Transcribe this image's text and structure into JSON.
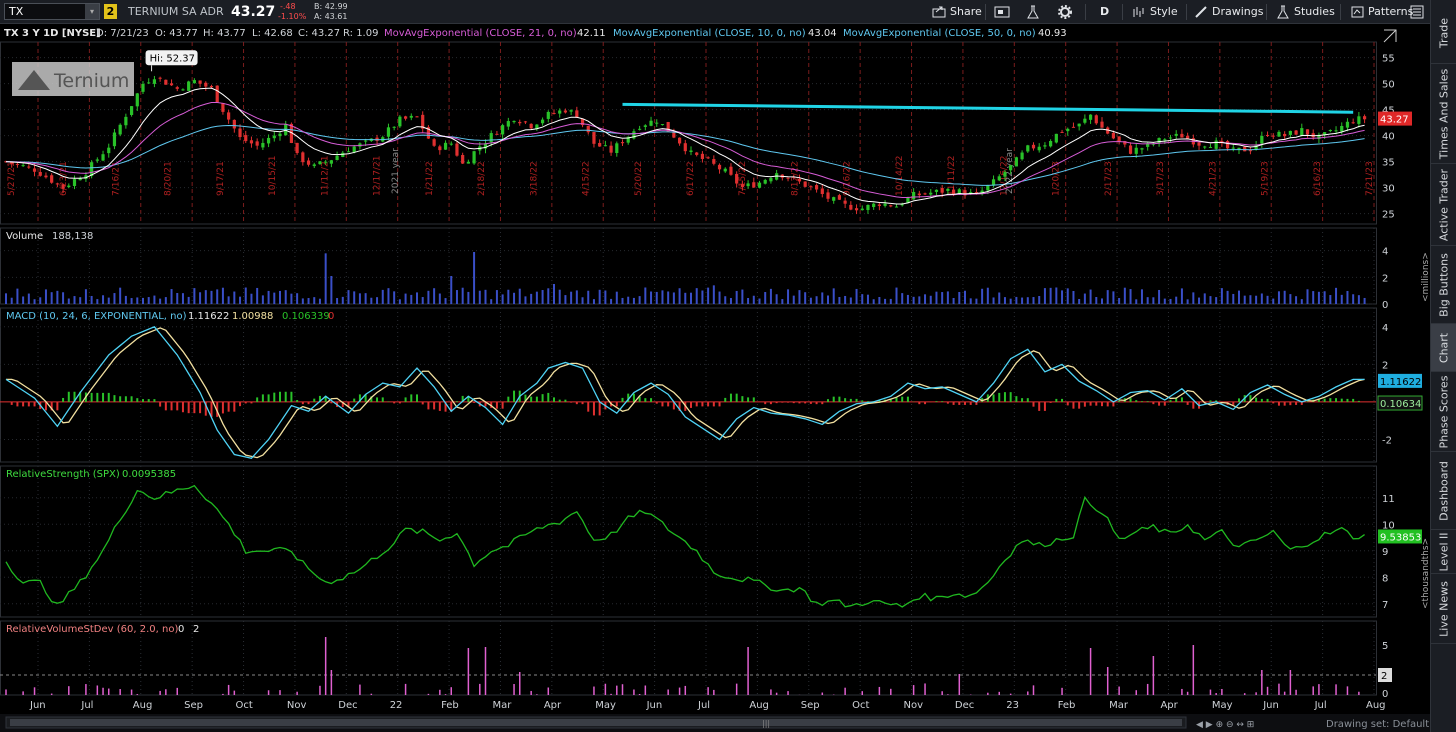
{
  "toolbar": {
    "symbol": "TX",
    "link_badge": "2",
    "company": "TERNIUM SA ADR",
    "last": "43.27",
    "change": "-.48",
    "change_pct": "-1.10%",
    "bid": "B: 42.99",
    "ask": "A: 43.61",
    "share": "Share",
    "period": "D",
    "style": "Style",
    "drawings": "Drawings",
    "studies": "Studies",
    "patterns": "Patterns"
  },
  "right_tabs": [
    "Trade",
    "Times And Sales",
    "Active Trader",
    "Big Buttons",
    "Chart",
    "Phase Scores",
    "Dashboard",
    "Level II",
    "Live News"
  ],
  "price_header": {
    "title": "TX 3 Y 1D [NYSE]",
    "date": "D: 7/21/23",
    "open": "O: 43.77",
    "high": "H: 43.77",
    "low": "L: 42.68",
    "close": "C: 43.27",
    "range": "R: 1.09",
    "ma21_label": "MovAvgExponential (CLOSE, 21, 0, no)",
    "ma21_value": "42.11",
    "ma10_label": "MovAvgExponential (CLOSE, 10, 0, no)",
    "ma10_value": "43.04",
    "ma50_label": "MovAvgExponential (CLOSE, 50, 0, no)",
    "ma50_value": "40.93"
  },
  "logo_text": "Ternium",
  "hi_label": "Hi: 52.37",
  "price_marker": "43.27",
  "year_labels": [
    "2021 year",
    "2022 year"
  ],
  "volume_header": {
    "label": "Volume",
    "value": "188,138"
  },
  "volume_unit": "<millions>",
  "macd_header": {
    "label": "MACD (10, 24, 6, EXPONENTIAL, no)",
    "v1": "1.11622",
    "v2": "1.00988",
    "v3": "0.106339",
    "v4": "0"
  },
  "macd_markers": {
    "macd": "1.11622",
    "diff": "0.10634"
  },
  "rs_header": {
    "label": "RelativeStrength (SPX)",
    "value": "0.0095385"
  },
  "rs_marker": "9.53853",
  "rs_unit": "<thousandths>",
  "rv_header": {
    "label": "RelativeVolumeStDev (60, 2.0, no)",
    "v1": "0",
    "v2": "2"
  },
  "rv_marker": "2",
  "footer": {
    "drawing_set": "Drawing set: Default"
  },
  "colors": {
    "up": "#29c229",
    "down": "#e03030",
    "ma21": "#d65cd6",
    "ma10": "#ffffff",
    "ma50": "#5fc8f0",
    "trendline": "#20d4e6",
    "macd": "#4fd3f5",
    "signal": "#f2e0a0",
    "rs": "#20b820",
    "rv": "#e060d0"
  },
  "chart_data": [
    {
      "type": "candlestick",
      "title": "TX 3 Y 1D [NYSE]",
      "series": [
        {
          "name": "MovAvgExponential (CLOSE, 21, 0, no)"
        },
        {
          "name": "MovAvgExponential (CLOSE, 10, 0, no)"
        },
        {
          "name": "MovAvgExponential (CLOSE, 50, 0, no)"
        }
      ],
      "ylim": [
        23,
        58
      ],
      "yticks": [
        25,
        30,
        35,
        40,
        45,
        50,
        55
      ],
      "x_month_labels": [
        "Jun",
        "Jul",
        "Aug",
        "Sep",
        "Oct",
        "Nov",
        "Dec",
        "22",
        "Feb",
        "Mar",
        "Apr",
        "May",
        "Jun",
        "Jul",
        "Aug",
        "Sep",
        "Oct",
        "Nov",
        "Dec",
        "23",
        "Feb",
        "Mar",
        "Apr",
        "May",
        "Jun",
        "Jul",
        "Aug"
      ],
      "date_labels": [
        "5/27/21",
        "6/23/21",
        "7/16/21",
        "8/20/21",
        "9/17/21",
        "10/15/21",
        "11/12/21",
        "12/17/21",
        "1/21/22",
        "2/18/22",
        "3/18/22",
        "4/15/22",
        "5/20/22",
        "6/17/22",
        "7/15/22",
        "8/12/22",
        "9/16/22",
        "10/14/22",
        "11/11/22",
        "12/16/22",
        "1/20/23",
        "2/17/23",
        "3/17/23",
        "4/21/23",
        "5/19/23",
        "6/16/23",
        "7/21/23"
      ],
      "close_path": [
        [
          0,
          35
        ],
        [
          5,
          33.5
        ],
        [
          10,
          30
        ],
        [
          14,
          33
        ],
        [
          18,
          38
        ],
        [
          21,
          44
        ],
        [
          24,
          50
        ],
        [
          26,
          51.5
        ],
        [
          30,
          49
        ],
        [
          33,
          50.5
        ],
        [
          36,
          49
        ],
        [
          38,
          45
        ],
        [
          41,
          39.5
        ],
        [
          44,
          38
        ],
        [
          47,
          40
        ],
        [
          49,
          42
        ],
        [
          51,
          36
        ],
        [
          54,
          34
        ],
        [
          57,
          35.5
        ],
        [
          60,
          37.5
        ],
        [
          63,
          38.5
        ],
        [
          66,
          40
        ],
        [
          69,
          43
        ],
        [
          72,
          43.5
        ],
        [
          75,
          37.5
        ],
        [
          78,
          38.5
        ],
        [
          80,
          34.5
        ],
        [
          83,
          38
        ],
        [
          86,
          41
        ],
        [
          89,
          43.5
        ],
        [
          92,
          42
        ],
        [
          95,
          44
        ],
        [
          98,
          45
        ],
        [
          100,
          44
        ],
        [
          103,
          38.5
        ],
        [
          106,
          37
        ],
        [
          109,
          40
        ],
        [
          111,
          42
        ],
        [
          114,
          43
        ],
        [
          117,
          40
        ],
        [
          120,
          36.5
        ],
        [
          123,
          35
        ],
        [
          126,
          33
        ],
        [
          129,
          30
        ],
        [
          132,
          31
        ],
        [
          135,
          33
        ],
        [
          138,
          31.5
        ],
        [
          141,
          30
        ],
        [
          144,
          28
        ],
        [
          147,
          26.5
        ],
        [
          150,
          26
        ],
        [
          153,
          27
        ],
        [
          156,
          26.5
        ],
        [
          159,
          28.5
        ],
        [
          162,
          29
        ],
        [
          165,
          29.5
        ],
        [
          168,
          29
        ],
        [
          170,
          28.5
        ],
        [
          173,
          31
        ],
        [
          176,
          34
        ],
        [
          179,
          37.5
        ],
        [
          182,
          38.5
        ],
        [
          185,
          41
        ],
        [
          188,
          42
        ],
        [
          190,
          44
        ],
        [
          192,
          41.5
        ],
        [
          194,
          39.5
        ],
        [
          197,
          37
        ],
        [
          200,
          38
        ],
        [
          203,
          39.5
        ],
        [
          206,
          40
        ],
        [
          209,
          38.5
        ],
        [
          212,
          38.5
        ],
        [
          215,
          37
        ],
        [
          218,
          37.5
        ],
        [
          221,
          40.5
        ],
        [
          224,
          40
        ],
        [
          227,
          41
        ],
        [
          230,
          39.5
        ],
        [
          233,
          41
        ],
        [
          236,
          43
        ],
        [
          238,
          43.27
        ]
      ],
      "hi": 52.37,
      "trendline": [
        [
          108,
          46.0
        ],
        [
          236,
          44.5
        ]
      ]
    },
    {
      "type": "bar",
      "title": "Volume",
      "unit": "millions",
      "ylim": [
        0,
        4.2
      ],
      "yticks": [
        0,
        2,
        4
      ],
      "last": 188138,
      "spikes": [
        [
          56,
          3.8
        ],
        [
          57,
          2.1
        ],
        [
          78,
          2.1
        ],
        [
          82,
          3.9
        ],
        [
          96,
          1.5
        ],
        [
          124,
          1.4
        ],
        [
          167,
          0.9
        ]
      ]
    },
    {
      "type": "line",
      "title": "MACD (10, 24, 6, EXPONENTIAL, no)",
      "ylim": [
        -3.2,
        5
      ],
      "yticks": [
        -2,
        2,
        4
      ],
      "series": [
        {
          "name": "MACD",
          "values_path": [
            [
              0,
              1.2
            ],
            [
              5,
              0.2
            ],
            [
              9,
              -1.3
            ],
            [
              13,
              0.5
            ],
            [
              18,
              2.5
            ],
            [
              22,
              3.5
            ],
            [
              26,
              4.0
            ],
            [
              30,
              2.5
            ],
            [
              34,
              0.5
            ],
            [
              37,
              -1.5
            ],
            [
              40,
              -2.8
            ],
            [
              43,
              -3.0
            ],
            [
              46,
              -2.0
            ],
            [
              50,
              -0.2
            ],
            [
              53,
              -0.5
            ],
            [
              56,
              0.3
            ],
            [
              60,
              -0.6
            ],
            [
              63,
              0.4
            ],
            [
              66,
              1.0
            ],
            [
              69,
              0.8
            ],
            [
              72,
              1.8
            ],
            [
              75,
              0.8
            ],
            [
              78,
              -0.5
            ],
            [
              81,
              0.3
            ],
            [
              84,
              -0.3
            ],
            [
              87,
              -1.2
            ],
            [
              90,
              0.3
            ],
            [
              93,
              1.0
            ],
            [
              95,
              1.8
            ],
            [
              98,
              2.1
            ],
            [
              101,
              1.8
            ],
            [
              104,
              0
            ],
            [
              107,
              -0.6
            ],
            [
              110,
              0.5
            ],
            [
              113,
              1.0
            ],
            [
              116,
              0.4
            ],
            [
              119,
              -0.8
            ],
            [
              122,
              -1.4
            ],
            [
              125,
              -2.0
            ],
            [
              128,
              -0.9
            ],
            [
              131,
              -0.3
            ],
            [
              134,
              -0.6
            ],
            [
              137,
              -0.7
            ],
            [
              140,
              -0.9
            ],
            [
              143,
              -1.2
            ],
            [
              146,
              -0.5
            ],
            [
              149,
              -0.1
            ],
            [
              152,
              0.0
            ],
            [
              155,
              0.3
            ],
            [
              158,
              1.0
            ],
            [
              161,
              0.7
            ],
            [
              164,
              0.8
            ],
            [
              167,
              0.4
            ],
            [
              170,
              0.0
            ],
            [
              173,
              1.0
            ],
            [
              176,
              2.3
            ],
            [
              179,
              2.8
            ],
            [
              182,
              1.6
            ],
            [
              185,
              2.0
            ],
            [
              188,
              1.1
            ],
            [
              191,
              0.6
            ],
            [
              194,
              0.0
            ],
            [
              197,
              0.5
            ],
            [
              200,
              0.6
            ],
            [
              203,
              0.1
            ],
            [
              206,
              0.7
            ],
            [
              209,
              -0.2
            ],
            [
              212,
              0.0
            ],
            [
              215,
              -0.4
            ],
            [
              218,
              0.5
            ],
            [
              221,
              0.9
            ],
            [
              224,
              0.4
            ],
            [
              227,
              0.0
            ],
            [
              230,
              0.3
            ],
            [
              233,
              0.8
            ],
            [
              236,
              1.2
            ]
          ]
        },
        {
          "name": "Signal",
          "lag": 1.5
        },
        {
          "name": "Diff"
        }
      ]
    },
    {
      "type": "line",
      "title": "RelativeStrength (SPX)",
      "unit": "thousandths",
      "ylim": [
        6.5,
        12.2
      ],
      "yticks": [
        7,
        8,
        9,
        10,
        11
      ],
      "values_path": [
        [
          0,
          8.6
        ],
        [
          3,
          7.8
        ],
        [
          6,
          7.8
        ],
        [
          9,
          6.9
        ],
        [
          13,
          7.8
        ],
        [
          17,
          9.0
        ],
        [
          20,
          10.2
        ],
        [
          23,
          11.3
        ],
        [
          26,
          11.0
        ],
        [
          29,
          11.2
        ],
        [
          33,
          11.5
        ],
        [
          36,
          10.8
        ],
        [
          39,
          10.0
        ],
        [
          42,
          9.0
        ],
        [
          46,
          9.0
        ],
        [
          50,
          9.0
        ],
        [
          52,
          8.5
        ],
        [
          56,
          7.8
        ],
        [
          59,
          8.0
        ],
        [
          62,
          8.3
        ],
        [
          65,
          8.8
        ],
        [
          68,
          9.3
        ],
        [
          70,
          9.8
        ],
        [
          73,
          9.7
        ],
        [
          76,
          9.4
        ],
        [
          79,
          9.7
        ],
        [
          82,
          8.5
        ],
        [
          85,
          9.0
        ],
        [
          88,
          9.2
        ],
        [
          91,
          9.6
        ],
        [
          94,
          9.9
        ],
        [
          97,
          10.1
        ],
        [
          100,
          10.5
        ],
        [
          103,
          9.4
        ],
        [
          106,
          9.6
        ],
        [
          109,
          10.2
        ],
        [
          112,
          10.5
        ],
        [
          115,
          10.0
        ],
        [
          118,
          9.5
        ],
        [
          121,
          9.0
        ],
        [
          124,
          8.2
        ],
        [
          127,
          8.0
        ],
        [
          130,
          7.9
        ],
        [
          133,
          7.7
        ],
        [
          136,
          7.5
        ],
        [
          139,
          7.6
        ],
        [
          142,
          7.0
        ],
        [
          145,
          7.1
        ],
        [
          148,
          6.9
        ],
        [
          151,
          7.1
        ],
        [
          154,
          7.0
        ],
        [
          157,
          6.9
        ],
        [
          160,
          7.3
        ],
        [
          163,
          7.2
        ],
        [
          166,
          7.4
        ],
        [
          169,
          7.3
        ],
        [
          172,
          7.8
        ],
        [
          175,
          8.7
        ],
        [
          178,
          9.4
        ],
        [
          181,
          9.2
        ],
        [
          184,
          9.4
        ],
        [
          187,
          9.6
        ],
        [
          189,
          10.9
        ],
        [
          192,
          10.5
        ],
        [
          195,
          9.4
        ],
        [
          198,
          9.7
        ],
        [
          201,
          9.9
        ],
        [
          204,
          9.6
        ],
        [
          207,
          10.0
        ],
        [
          210,
          9.4
        ],
        [
          213,
          9.7
        ],
        [
          216,
          9.1
        ],
        [
          219,
          9.4
        ],
        [
          222,
          9.7
        ],
        [
          225,
          9.0
        ],
        [
          228,
          9.3
        ],
        [
          231,
          9.6
        ],
        [
          234,
          9.8
        ],
        [
          236,
          9.54
        ]
      ]
    },
    {
      "type": "bar",
      "title": "RelativeVolumeStDev (60, 2.0, no)",
      "ylim": [
        0,
        6
      ],
      "yticks": [
        0,
        2,
        5
      ],
      "threshold": 2,
      "spikes": [
        [
          56,
          5.8
        ],
        [
          57,
          2.5
        ],
        [
          81,
          4.7
        ],
        [
          84,
          4.8
        ],
        [
          90,
          2.3
        ],
        [
          130,
          4.8
        ],
        [
          167,
          2.1
        ],
        [
          190,
          4.7
        ],
        [
          193,
          2.8
        ],
        [
          201,
          3.9
        ],
        [
          208,
          5.0
        ],
        [
          220,
          2.5
        ],
        [
          225,
          2.5
        ]
      ]
    }
  ]
}
